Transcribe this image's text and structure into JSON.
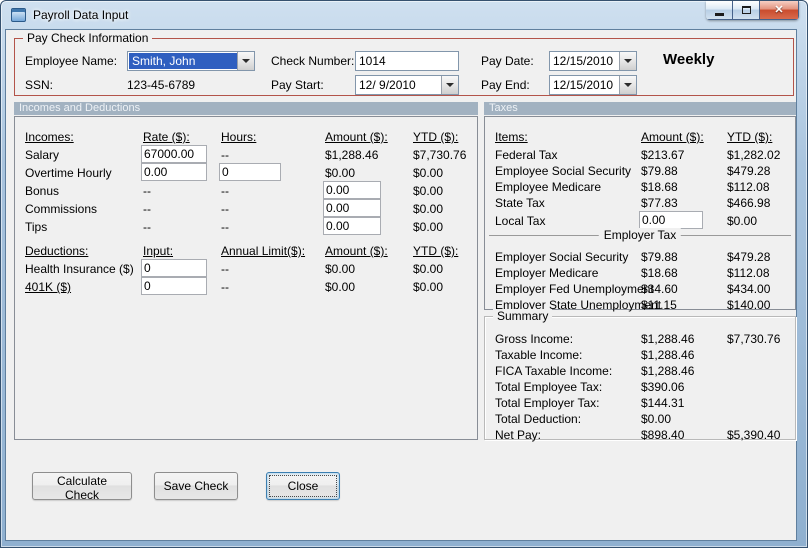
{
  "colors": {
    "paycheck_border": "#b3544a",
    "section_band_bg": "#a2b2c1",
    "selection_blue": "#2f5fc0",
    "titlebar_blue": "#a9c4de",
    "close_button_red": "#c94c2e",
    "client_bg": "#f0f0f0"
  },
  "window": {
    "title": "Payroll Data Input",
    "close_glyph": "✕"
  },
  "paycheck": {
    "legend": "Pay Check Information",
    "employee_name_label": "Employee Name:",
    "employee_name_value": "Smith, John",
    "ssn_label": "SSN:",
    "ssn_value": "123-45-6789",
    "check_number_label": "Check Number:",
    "check_number_value": "1014",
    "pay_start_label": "Pay Start:",
    "pay_start_value": "12/ 9/2010",
    "pay_date_label": "Pay Date:",
    "pay_date_value": "12/15/2010",
    "pay_end_label": "Pay End:",
    "pay_end_value": "12/15/2010",
    "frequency": "Weekly"
  },
  "sections": {
    "left_header": "Incomes and Deductions",
    "right_header": "Taxes"
  },
  "incomes": {
    "headers": {
      "name": "Incomes:",
      "rate": "Rate ($):",
      "hours": "Hours:",
      "amount": "Amount ($):",
      "ytd": "YTD ($):"
    },
    "rows": [
      {
        "name": "Salary",
        "rate": "67000.00",
        "hours": "--",
        "amount": "$1,288.46",
        "ytd": "$7,730.76"
      },
      {
        "name": "Overtime Hourly",
        "rate": "0.00",
        "hours": "0",
        "amount": "$0.00",
        "ytd": "$0.00"
      },
      {
        "name": "Bonus",
        "rate": "--",
        "hours": "--",
        "amount": "0.00",
        "ytd": "$0.00"
      },
      {
        "name": "Commissions",
        "rate": "--",
        "hours": "--",
        "amount": "0.00",
        "ytd": "$0.00"
      },
      {
        "name": "Tips",
        "rate": "--",
        "hours": "--",
        "amount": "0.00",
        "ytd": "$0.00"
      }
    ]
  },
  "deductions": {
    "headers": {
      "name": "Deductions:",
      "input": "Input:",
      "limit": "Annual Limit($):",
      "amount": "Amount ($):",
      "ytd": "YTD ($):"
    },
    "rows": [
      {
        "name": "Health Insurance ($)",
        "input": "0",
        "limit": "--",
        "amount": "$0.00",
        "ytd": "$0.00"
      },
      {
        "name": "401K ($)",
        "input": "0",
        "limit": "--",
        "amount": "$0.00",
        "ytd": "$0.00"
      }
    ]
  },
  "taxes": {
    "headers": {
      "items": "Items:",
      "amount": "Amount ($):",
      "ytd": "YTD ($):"
    },
    "employee_rows": [
      {
        "name": "Federal Tax",
        "amount": "$213.67",
        "ytd": "$1,282.02"
      },
      {
        "name": "Employee Social Security",
        "amount": "$79.88",
        "ytd": "$479.28"
      },
      {
        "name": "Employee Medicare",
        "amount": "$18.68",
        "ytd": "$112.08"
      },
      {
        "name": "State Tax",
        "amount": "$77.83",
        "ytd": "$466.98"
      }
    ],
    "local_tax": {
      "name": "Local Tax",
      "amount": "0.00",
      "ytd": "$0.00"
    },
    "employer_header": "Employer Tax",
    "employer_rows": [
      {
        "name": "Employer Social Security",
        "amount": "$79.88",
        "ytd": "$479.28"
      },
      {
        "name": "Employer Medicare",
        "amount": "$18.68",
        "ytd": "$112.08"
      },
      {
        "name": "Employer Fed Unemployment",
        "amount": "$34.60",
        "ytd": "$434.00"
      },
      {
        "name": "Employer State Unemployment",
        "amount": "$11.15",
        "ytd": "$140.00"
      }
    ]
  },
  "summary": {
    "legend": "Summary",
    "rows": [
      {
        "name": "Gross Income:",
        "amount": "$1,288.46",
        "ytd": "$7,730.76"
      },
      {
        "name": "Taxable Income:",
        "amount": "$1,288.46",
        "ytd": ""
      },
      {
        "name": "FICA Taxable Income:",
        "amount": "$1,288.46",
        "ytd": ""
      },
      {
        "name": "Total Employee Tax:",
        "amount": "$390.06",
        "ytd": ""
      },
      {
        "name": "Total Employer Tax:",
        "amount": "$144.31",
        "ytd": ""
      },
      {
        "name": "Total Deduction:",
        "amount": "$0.00",
        "ytd": ""
      },
      {
        "name": "Net Pay:",
        "amount": "$898.40",
        "ytd": "$5,390.40"
      }
    ]
  },
  "buttons": {
    "calculate": "Calculate Check",
    "save": "Save Check",
    "close": "Close"
  }
}
